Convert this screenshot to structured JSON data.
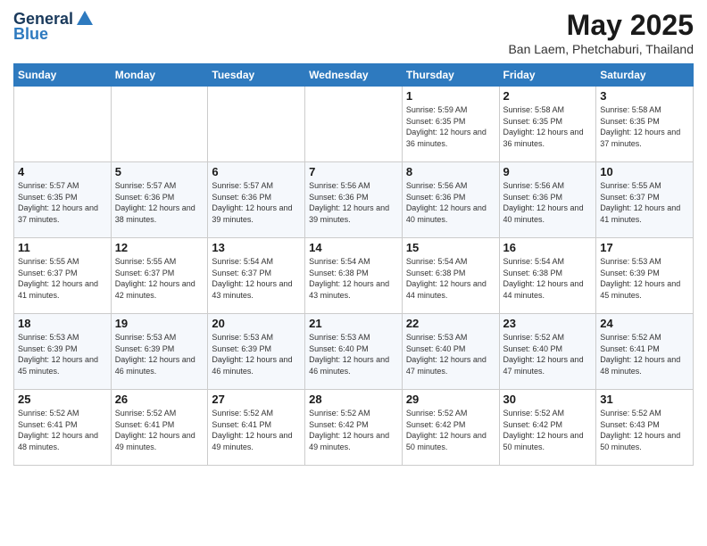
{
  "logo": {
    "general": "General",
    "blue": "Blue"
  },
  "title": "May 2025",
  "subtitle": "Ban Laem, Phetchaburi, Thailand",
  "days_of_week": [
    "Sunday",
    "Monday",
    "Tuesday",
    "Wednesday",
    "Thursday",
    "Friday",
    "Saturday"
  ],
  "weeks": [
    [
      {
        "day": "",
        "sunrise": "",
        "sunset": "",
        "daylight": ""
      },
      {
        "day": "",
        "sunrise": "",
        "sunset": "",
        "daylight": ""
      },
      {
        "day": "",
        "sunrise": "",
        "sunset": "",
        "daylight": ""
      },
      {
        "day": "",
        "sunrise": "",
        "sunset": "",
        "daylight": ""
      },
      {
        "day": "1",
        "sunrise": "Sunrise: 5:59 AM",
        "sunset": "Sunset: 6:35 PM",
        "daylight": "Daylight: 12 hours and 36 minutes."
      },
      {
        "day": "2",
        "sunrise": "Sunrise: 5:58 AM",
        "sunset": "Sunset: 6:35 PM",
        "daylight": "Daylight: 12 hours and 36 minutes."
      },
      {
        "day": "3",
        "sunrise": "Sunrise: 5:58 AM",
        "sunset": "Sunset: 6:35 PM",
        "daylight": "Daylight: 12 hours and 37 minutes."
      }
    ],
    [
      {
        "day": "4",
        "sunrise": "Sunrise: 5:57 AM",
        "sunset": "Sunset: 6:35 PM",
        "daylight": "Daylight: 12 hours and 37 minutes."
      },
      {
        "day": "5",
        "sunrise": "Sunrise: 5:57 AM",
        "sunset": "Sunset: 6:36 PM",
        "daylight": "Daylight: 12 hours and 38 minutes."
      },
      {
        "day": "6",
        "sunrise": "Sunrise: 5:57 AM",
        "sunset": "Sunset: 6:36 PM",
        "daylight": "Daylight: 12 hours and 39 minutes."
      },
      {
        "day": "7",
        "sunrise": "Sunrise: 5:56 AM",
        "sunset": "Sunset: 6:36 PM",
        "daylight": "Daylight: 12 hours and 39 minutes."
      },
      {
        "day": "8",
        "sunrise": "Sunrise: 5:56 AM",
        "sunset": "Sunset: 6:36 PM",
        "daylight": "Daylight: 12 hours and 40 minutes."
      },
      {
        "day": "9",
        "sunrise": "Sunrise: 5:56 AM",
        "sunset": "Sunset: 6:36 PM",
        "daylight": "Daylight: 12 hours and 40 minutes."
      },
      {
        "day": "10",
        "sunrise": "Sunrise: 5:55 AM",
        "sunset": "Sunset: 6:37 PM",
        "daylight": "Daylight: 12 hours and 41 minutes."
      }
    ],
    [
      {
        "day": "11",
        "sunrise": "Sunrise: 5:55 AM",
        "sunset": "Sunset: 6:37 PM",
        "daylight": "Daylight: 12 hours and 41 minutes."
      },
      {
        "day": "12",
        "sunrise": "Sunrise: 5:55 AM",
        "sunset": "Sunset: 6:37 PM",
        "daylight": "Daylight: 12 hours and 42 minutes."
      },
      {
        "day": "13",
        "sunrise": "Sunrise: 5:54 AM",
        "sunset": "Sunset: 6:37 PM",
        "daylight": "Daylight: 12 hours and 43 minutes."
      },
      {
        "day": "14",
        "sunrise": "Sunrise: 5:54 AM",
        "sunset": "Sunset: 6:38 PM",
        "daylight": "Daylight: 12 hours and 43 minutes."
      },
      {
        "day": "15",
        "sunrise": "Sunrise: 5:54 AM",
        "sunset": "Sunset: 6:38 PM",
        "daylight": "Daylight: 12 hours and 44 minutes."
      },
      {
        "day": "16",
        "sunrise": "Sunrise: 5:54 AM",
        "sunset": "Sunset: 6:38 PM",
        "daylight": "Daylight: 12 hours and 44 minutes."
      },
      {
        "day": "17",
        "sunrise": "Sunrise: 5:53 AM",
        "sunset": "Sunset: 6:39 PM",
        "daylight": "Daylight: 12 hours and 45 minutes."
      }
    ],
    [
      {
        "day": "18",
        "sunrise": "Sunrise: 5:53 AM",
        "sunset": "Sunset: 6:39 PM",
        "daylight": "Daylight: 12 hours and 45 minutes."
      },
      {
        "day": "19",
        "sunrise": "Sunrise: 5:53 AM",
        "sunset": "Sunset: 6:39 PM",
        "daylight": "Daylight: 12 hours and 46 minutes."
      },
      {
        "day": "20",
        "sunrise": "Sunrise: 5:53 AM",
        "sunset": "Sunset: 6:39 PM",
        "daylight": "Daylight: 12 hours and 46 minutes."
      },
      {
        "day": "21",
        "sunrise": "Sunrise: 5:53 AM",
        "sunset": "Sunset: 6:40 PM",
        "daylight": "Daylight: 12 hours and 46 minutes."
      },
      {
        "day": "22",
        "sunrise": "Sunrise: 5:53 AM",
        "sunset": "Sunset: 6:40 PM",
        "daylight": "Daylight: 12 hours and 47 minutes."
      },
      {
        "day": "23",
        "sunrise": "Sunrise: 5:52 AM",
        "sunset": "Sunset: 6:40 PM",
        "daylight": "Daylight: 12 hours and 47 minutes."
      },
      {
        "day": "24",
        "sunrise": "Sunrise: 5:52 AM",
        "sunset": "Sunset: 6:41 PM",
        "daylight": "Daylight: 12 hours and 48 minutes."
      }
    ],
    [
      {
        "day": "25",
        "sunrise": "Sunrise: 5:52 AM",
        "sunset": "Sunset: 6:41 PM",
        "daylight": "Daylight: 12 hours and 48 minutes."
      },
      {
        "day": "26",
        "sunrise": "Sunrise: 5:52 AM",
        "sunset": "Sunset: 6:41 PM",
        "daylight": "Daylight: 12 hours and 49 minutes."
      },
      {
        "day": "27",
        "sunrise": "Sunrise: 5:52 AM",
        "sunset": "Sunset: 6:41 PM",
        "daylight": "Daylight: 12 hours and 49 minutes."
      },
      {
        "day": "28",
        "sunrise": "Sunrise: 5:52 AM",
        "sunset": "Sunset: 6:42 PM",
        "daylight": "Daylight: 12 hours and 49 minutes."
      },
      {
        "day": "29",
        "sunrise": "Sunrise: 5:52 AM",
        "sunset": "Sunset: 6:42 PM",
        "daylight": "Daylight: 12 hours and 50 minutes."
      },
      {
        "day": "30",
        "sunrise": "Sunrise: 5:52 AM",
        "sunset": "Sunset: 6:42 PM",
        "daylight": "Daylight: 12 hours and 50 minutes."
      },
      {
        "day": "31",
        "sunrise": "Sunrise: 5:52 AM",
        "sunset": "Sunset: 6:43 PM",
        "daylight": "Daylight: 12 hours and 50 minutes."
      }
    ]
  ]
}
